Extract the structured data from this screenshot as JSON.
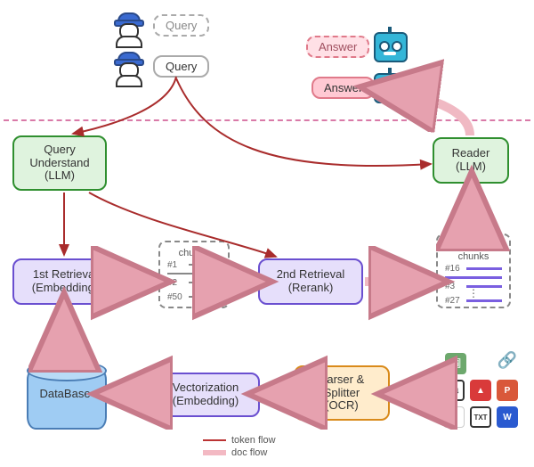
{
  "top": {
    "query_dashed": "Query",
    "query_solid": "Query",
    "answer_dashed": "Answer",
    "answer_solid": "Answer"
  },
  "nodes": {
    "query_understand": "Query\nUnderstand\n(LLM)",
    "reader": "Reader\n(LLM)",
    "first_retrieval": "1st Retrieval\n(Embedding)",
    "second_retrieval": "2nd Retrieval\n(Rerank)",
    "vectorization": "Vectorization\n(Embedding)",
    "parser": "Parser &\nSplitter\n(OCR)",
    "database": "DataBase"
  },
  "chunks": {
    "title": "chunks",
    "ids": [
      "#1",
      "#2",
      "#50"
    ]
  },
  "reranked": {
    "title": "reranked\nchunks",
    "ids": [
      "#16",
      "#3",
      "#27"
    ]
  },
  "legend": {
    "token": "token flow",
    "doc": "doc flow"
  },
  "doc_icons": {
    "image": "image-icon",
    "link": "link-icon",
    "markdown": "M↓",
    "pdf": "pdf-icon",
    "ppt": "P",
    "gmail": "M",
    "txt": "TXT",
    "word": "W"
  }
}
